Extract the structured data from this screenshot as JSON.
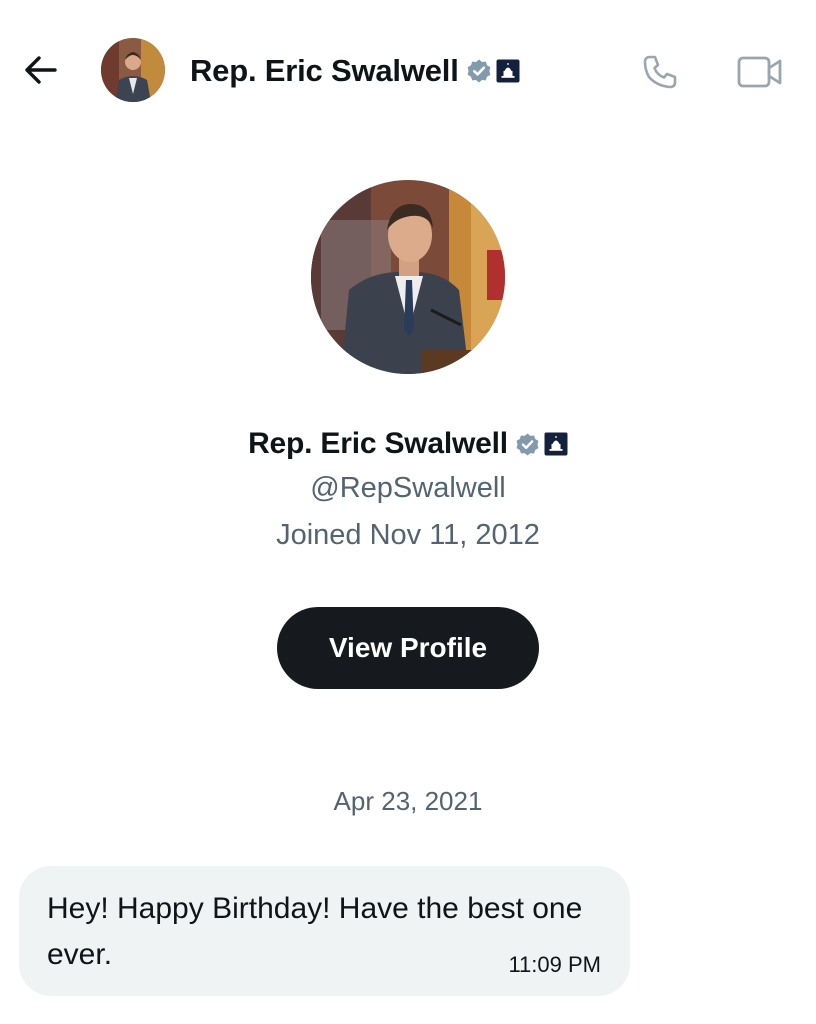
{
  "header": {
    "back_icon": "arrow-left-icon",
    "name": "Rep. Eric Swalwell",
    "verified_icon": "verified-badge-icon",
    "gov_icon": "government-capitol-badge-icon",
    "call_icon": "phone-icon",
    "video_icon": "video-camera-icon"
  },
  "profile": {
    "name": "Rep. Eric Swalwell",
    "handle": "@RepSwalwell",
    "joined": "Joined Nov 11, 2012",
    "view_profile_label": "View Profile"
  },
  "conversation": {
    "date_separator": "Apr 23, 2021",
    "messages": [
      {
        "text": "Hey! Happy Birthday! Have the best one ever.",
        "time": "11:09 PM"
      }
    ]
  },
  "colors": {
    "text_primary": "#0f1419",
    "text_secondary": "#536471",
    "verified_badge": "#829aab",
    "gov_badge": "#14213d",
    "button_bg": "#16191d",
    "bubble_bg": "#eff3f4"
  }
}
